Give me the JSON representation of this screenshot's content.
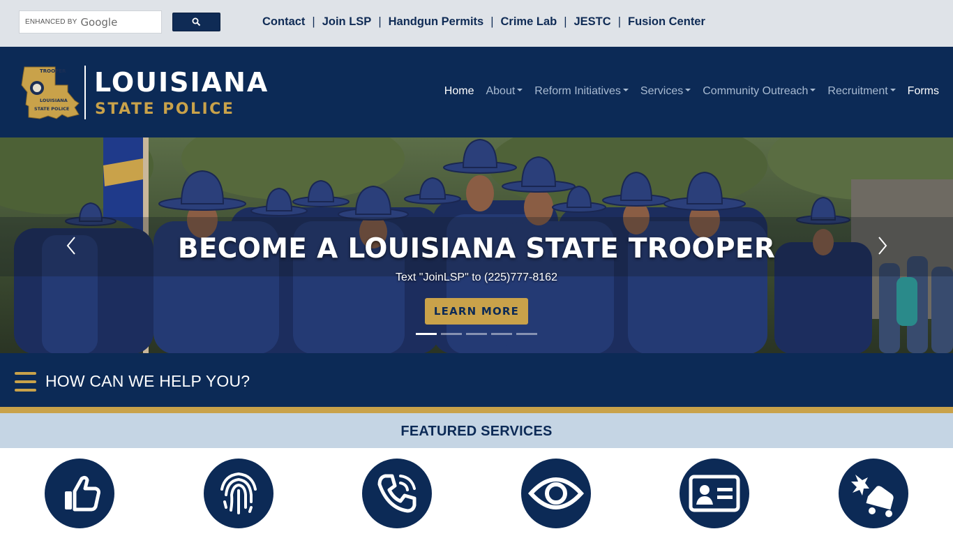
{
  "utility_bar": {
    "search": {
      "enhanced_label": "ENHANCED BY",
      "brand": "Google",
      "button_icon": "search-icon"
    },
    "links": [
      "Contact",
      "Join LSP",
      "Handgun Permits",
      "Crime Lab",
      "JESTC",
      "Fusion Center"
    ]
  },
  "header": {
    "logo_title": "LOUISIANA",
    "logo_subtitle": "STATE POLICE",
    "nav": [
      {
        "label": "Home",
        "dropdown": false,
        "active": true
      },
      {
        "label": "About",
        "dropdown": true,
        "active": false
      },
      {
        "label": "Reform Initiatives",
        "dropdown": true,
        "active": false
      },
      {
        "label": "Services",
        "dropdown": true,
        "active": false
      },
      {
        "label": "Community Outreach",
        "dropdown": true,
        "active": false
      },
      {
        "label": "Recruitment",
        "dropdown": true,
        "active": false
      },
      {
        "label": "Forms",
        "dropdown": false,
        "active": false
      }
    ]
  },
  "hero": {
    "title": "BECOME A LOUISIANA STATE TROOPER",
    "subtitle": "Text \"JoinLSP\" to (225)777-8162",
    "button_label": "LEARN MORE",
    "slide_count": 5,
    "active_slide": 1
  },
  "help": {
    "label": "HOW CAN WE HELP YOU?"
  },
  "featured": {
    "title": "FEATURED SERVICES",
    "icons": [
      "thumbs-up-icon",
      "fingerprint-icon",
      "phone-call-icon",
      "eye-icon",
      "id-card-icon",
      "car-crash-icon"
    ]
  },
  "colors": {
    "navy": "#0c2a56",
    "gold": "#c9a24a",
    "light_blue": "#c5d5e4",
    "util_gray": "#dfe3e8"
  }
}
